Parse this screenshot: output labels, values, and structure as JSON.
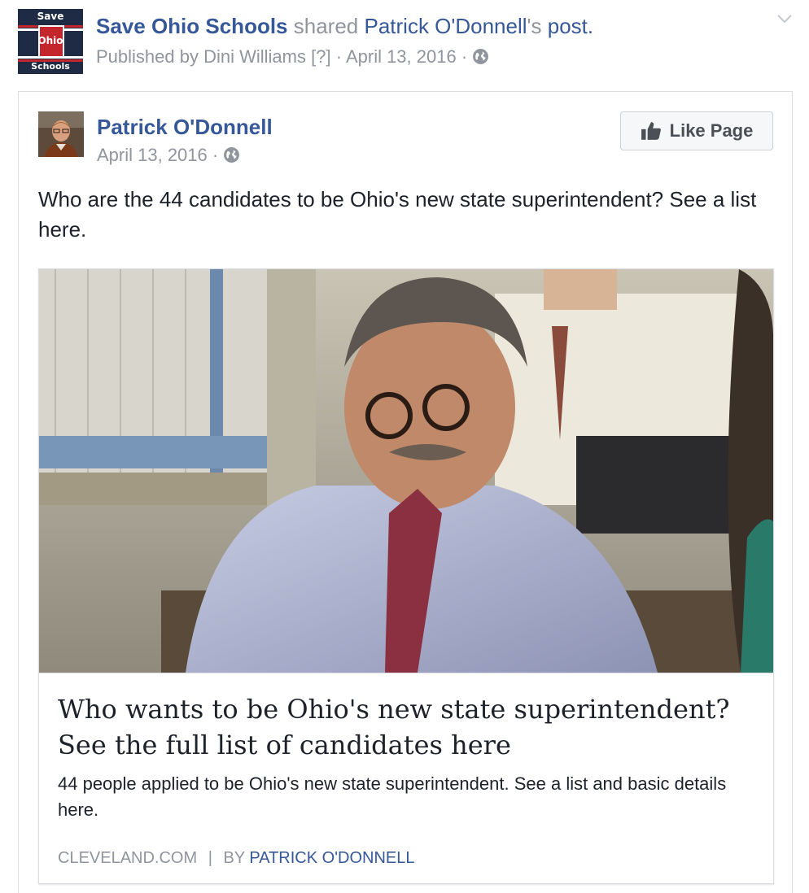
{
  "shared_post": {
    "page_name": "Save Ohio Schools",
    "shared_text": "shared",
    "original_author_link": "Patrick O'Donnell",
    "possessive": "'s",
    "post_link": "post.",
    "published_by_prefix": "Published by",
    "publisher": "Dini Williams",
    "help_marker": "[?]",
    "sep_dot": "·",
    "date": "April 13, 2016",
    "logo": {
      "top_text": "Save",
      "middle_text": "Ohio",
      "bottom_text": "Schools",
      "colors": {
        "navy": "#1f2a44",
        "red": "#c4262e"
      }
    },
    "menu_icon": "chevron-down-icon",
    "audience_icon": "globe-icon"
  },
  "inner_post": {
    "author": "Patrick O'Donnell",
    "date": "April 13, 2016",
    "sep_dot": "·",
    "like_button_label": "Like Page",
    "like_icon": "thumbs-up-icon",
    "audience_icon": "globe-icon",
    "text": "Who are the 44 candidates to be Ohio's new state superintendent? See a list here."
  },
  "link_preview": {
    "title": "Who wants to be Ohio's new state superintendent? See the full list of candidates here",
    "description": "44 people applied to be Ohio's new state superintendent. See a list and basic details here.",
    "source_domain": "cleveland.com",
    "separator": "|",
    "byline_prefix": "By",
    "byline_author": "Patrick O'Donnell"
  },
  "colors": {
    "link_blue": "#365899",
    "meta_grey": "#90949c",
    "text_dark": "#1d2129",
    "border": "#dddfe2"
  }
}
